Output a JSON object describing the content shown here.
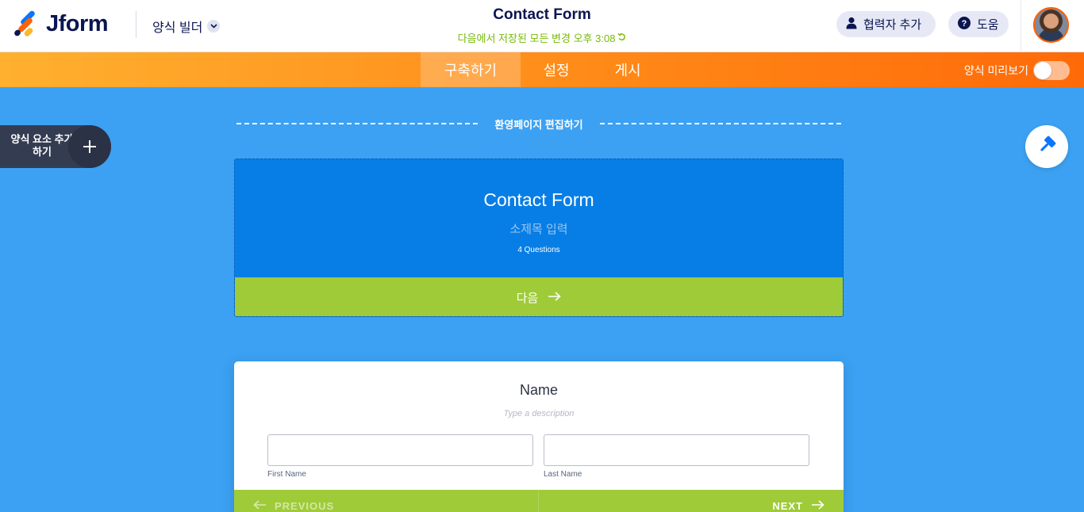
{
  "header": {
    "logo_text": "Jform",
    "builder_mode": "양식 빌더",
    "form_title": "Contact Form",
    "save_status": "다음에서 저장된 모든 변경 오후 3:08",
    "collaborator_button": "협력자 추가",
    "help_button": "도움"
  },
  "navbar": {
    "tabs": [
      {
        "label": "구축하기",
        "active": true
      },
      {
        "label": "설정",
        "active": false
      },
      {
        "label": "게시",
        "active": false
      }
    ],
    "preview_label": "양식 미리보기",
    "preview_on": false
  },
  "sidebar": {
    "add_element_label": "양식 요소 추가하기"
  },
  "canvas": {
    "welcome_edit_label": "환영페이지 편집하기",
    "welcome": {
      "title": "Contact Form",
      "subtitle": "소제목 입력",
      "questions_count": "4 Questions",
      "next_label": "다음"
    },
    "question": {
      "label": "Name",
      "description": "Type a description",
      "first_sublabel": "First Name",
      "last_sublabel": "Last Name",
      "prev_label": "PREVIOUS",
      "next_label": "NEXT"
    }
  },
  "colors": {
    "brand_orange": "#ff6100",
    "canvas_blue": "#3ca1f2",
    "welcome_blue": "#077ee5",
    "action_green": "#9fcb39",
    "save_green": "#78bb07"
  }
}
